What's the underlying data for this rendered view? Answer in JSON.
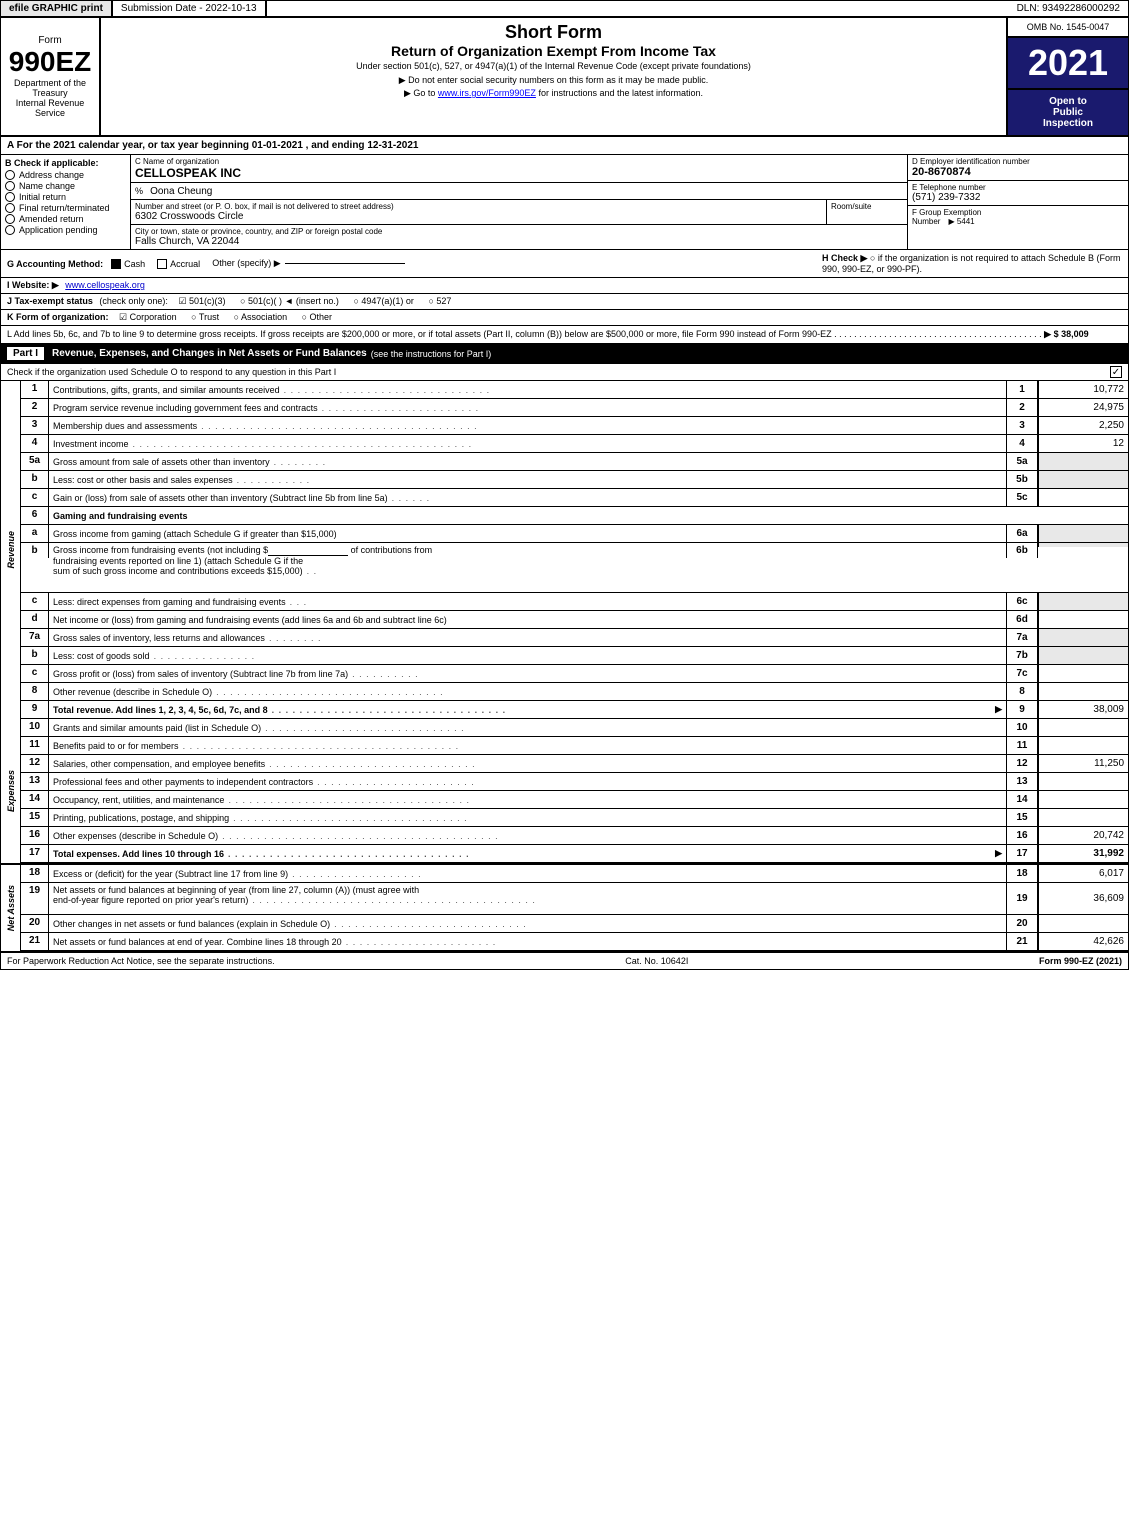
{
  "topBar": {
    "efile": "efile GRAPHIC print",
    "submission": "Submission Date - 2022-10-13",
    "dln": "DLN: 93492286000292"
  },
  "header": {
    "formType": "990EZ",
    "deptLine1": "Department of the",
    "deptLine2": "Treasury",
    "deptLine3": "Internal Revenue",
    "deptLine4": "Service",
    "title1": "Short Form",
    "title2": "Return of Organization Exempt From Income Tax",
    "subtitle": "Under section 501(c), 527, or 4947(a)(1) of the Internal Revenue Code (except private foundations)",
    "bullet1": "▶ Do not enter social security numbers on this form as it may be made public.",
    "bullet2": "▶ Go to ",
    "link": "www.irs.gov/Form990EZ",
    "linkSuffix": " for instructions and the latest information.",
    "ombNo": "OMB No. 1545-0047",
    "year": "2021",
    "openInspection": "Open to\nPublic\nInspection"
  },
  "sectionA": {
    "text": "A  For the 2021 calendar year, or tax year beginning 01-01-2021 , and ending 12-31-2021"
  },
  "checkB": {
    "label": "B  Check if applicable:",
    "items": [
      {
        "label": "Address change",
        "checked": false
      },
      {
        "label": "Name change",
        "checked": false
      },
      {
        "label": "Initial return",
        "checked": false
      },
      {
        "label": "Final return/terminated",
        "checked": false
      },
      {
        "label": "Amended return",
        "checked": false
      },
      {
        "label": "Application pending",
        "checked": false
      }
    ]
  },
  "orgInfo": {
    "cLabel": "C  Name of organization",
    "orgName": "CELLOSPEAK INC",
    "pctLabel": "%",
    "personName": "Oona Cheung",
    "addressLabel": "Number and street (or P. O. box, if mail is not delivered to street address)",
    "address": "6302 Crosswoods Circle",
    "roomLabel": "Room/suite",
    "roomValue": "",
    "cityLabel": "City or town, state or province, country, and ZIP or foreign postal code",
    "city": "Falls Church, VA  22044",
    "dLabel": "D  Employer identification number",
    "ein": "20-8670874",
    "eLabel": "E  Telephone number",
    "phone": "(571) 239-7332",
    "fLabel": "F  Group Exemption",
    "fLabel2": "Number",
    "groupNumber": "▶ 5441"
  },
  "accounting": {
    "gLabel": "G  Accounting Method:",
    "cashChecked": true,
    "accrualChecked": false,
    "otherLabel": "Other (specify) ▶",
    "otherValue": "",
    "hLabel": "H  Check ▶",
    "hText": "○  if the organization is not required to attach Schedule B (Form 990, 990-EZ, or 990-PF)."
  },
  "website": {
    "iLabel": "I  Website: ▶",
    "url": "www.cellospeak.org"
  },
  "taxStatus": {
    "jLabel": "J  Tax-exempt status",
    "jSub": "(check only one):",
    "options": [
      {
        "label": "☑ 501(c)(3)",
        "checked": true
      },
      {
        "label": "○ 501(c)(  )  ◄ (insert no.)",
        "checked": false
      },
      {
        "label": "○ 4947(a)(1) or",
        "checked": false
      },
      {
        "label": "○ 527",
        "checked": false
      }
    ]
  },
  "formOrg": {
    "kLabel": "K  Form of organization:",
    "options": [
      {
        "label": "☑ Corporation",
        "checked": true
      },
      {
        "label": "○ Trust",
        "checked": false
      },
      {
        "label": "○ Association",
        "checked": false
      },
      {
        "label": "○ Other",
        "checked": false
      }
    ]
  },
  "addLines": {
    "lText": "L  Add lines 5b, 6c, and 7b to line 9 to determine gross receipts. If gross receipts are $200,000 or more, or if total assets (Part II, column (B)) below are $500,000 or more, file Form 990 instead of Form 990-EZ",
    "dots": ". . . . . . . . . . . . . . . . . . . . . . . . . . . . . . . . . . . . . . . . . .",
    "arrow": "▶",
    "amount": "$ 38,009"
  },
  "partI": {
    "label": "Part I",
    "title": "Revenue, Expenses, and Changes in Net Assets or Fund Balances",
    "titleNote": "(see the instructions for Part I)",
    "checkLine": "Check if the organization used Schedule O to respond to any question in this Part I",
    "rows": [
      {
        "num": "1",
        "desc": "Contributions, gifts, grants, and similar amounts received",
        "dots": ". . . . . . . . . . . . . . . . . . . . . . . . . . . . . .",
        "lineNum": "1",
        "amount": "10,772",
        "blank": false
      },
      {
        "num": "2",
        "desc": "Program service revenue including government fees and contracts",
        "dots": ". . . . . . . . . . . . . . . . . . . . . . .",
        "lineNum": "2",
        "amount": "24,975",
        "blank": false
      },
      {
        "num": "3",
        "desc": "Membership dues and assessments",
        "dots": ". . . . . . . . . . . . . . . . . . . . . . . . . . . . . . . . . . . . . . . .",
        "lineNum": "3",
        "amount": "2,250",
        "blank": false
      },
      {
        "num": "4",
        "desc": "Investment income",
        "dots": ". . . . . . . . . . . . . . . . . . . . . . . . . . . . . . . . . . . . . . . . . . . . . . . . .",
        "lineNum": "4",
        "amount": "12",
        "blank": false
      }
    ],
    "row5a": {
      "num": "5a",
      "desc": "Gross amount from sale of assets other than inventory",
      "dots": ". . . . . . . .",
      "lineNum": "5a",
      "amount": "",
      "blank": true
    },
    "row5b": {
      "num": "b",
      "desc": "Less: cost or other basis and sales expenses",
      "dots": ". . . . . . . . . . .",
      "lineNum": "5b",
      "amount": "",
      "blank": true
    },
    "row5c": {
      "num": "c",
      "desc": "Gain or (loss) from sale of assets other than inventory (Subtract line 5b from line 5a)",
      "dots": ". . . . . .",
      "lineNum": "5c",
      "amount": "",
      "blank": false
    },
    "row6header": {
      "num": "6",
      "desc": "Gaming and fundraising events"
    },
    "row6a": {
      "num": "a",
      "desc": "Gross income from gaming (attach Schedule G if greater than $15,000)",
      "lineNum": "6a",
      "amount": "",
      "blank": true
    },
    "row6b": {
      "num": "b",
      "desc1": "Gross income from fundraising events (not including $",
      "desc2": "of contributions from",
      "desc3": "fundraising events reported on line 1) (attach Schedule G if the",
      "desc4": "sum of such gross income and contributions exceeds $15,000)",
      "dots": ". .",
      "lineNum": "6b",
      "amount": "",
      "blank": true
    },
    "row6c": {
      "num": "c",
      "desc": "Less: direct expenses from gaming and fundraising events",
      "dots": ". . .",
      "lineNum": "6c",
      "amount": "",
      "blank": true
    },
    "row6d": {
      "num": "d",
      "desc": "Net income or (loss) from gaming and fundraising events (add lines 6a and 6b and subtract line 6c)",
      "lineNum": "6d",
      "amount": "",
      "blank": false
    },
    "row7a": {
      "num": "7a",
      "desc": "Gross sales of inventory, less returns and allowances",
      "dots": ". . . . . . . .",
      "lineNum": "7a",
      "amount": "",
      "blank": true
    },
    "row7b": {
      "num": "b",
      "desc": "Less: cost of goods sold",
      "dots": ". . . . . . . . . . . . . . .",
      "lineNum": "7b",
      "amount": "",
      "blank": true
    },
    "row7c": {
      "num": "c",
      "desc": "Gross profit or (loss) from sales of inventory (Subtract line 7b from line 7a)",
      "dots": ". . . . . . . . . .",
      "lineNum": "7c",
      "amount": "",
      "blank": false
    },
    "row8": {
      "num": "8",
      "desc": "Other revenue (describe in Schedule O)",
      "dots": ". . . . . . . . . . . . . . . . . . . . . . . . . . . . . . . . .",
      "lineNum": "8",
      "amount": "",
      "blank": false
    },
    "row9": {
      "num": "9",
      "desc": "Total revenue. Add lines 1, 2, 3, 4, 5c, 6d, 7c, and 8",
      "dots": ". . . . . . . . . . . . . . . . . . . . . . . . . . . . . . . . . .",
      "arrow": "▶",
      "lineNum": "9",
      "amount": "38,009",
      "blank": false
    }
  },
  "expenses": {
    "rows": [
      {
        "num": "10",
        "desc": "Grants and similar amounts paid (list in Schedule O)",
        "dots": ". . . . . . . . . . . . . . . . . . . . . . . . . . . . .",
        "lineNum": "10",
        "amount": "",
        "blank": false
      },
      {
        "num": "11",
        "desc": "Benefits paid to or for members",
        "dots": ". . . . . . . . . . . . . . . . . . . . . . . . . . . . . . . . . . . . . . . .",
        "lineNum": "11",
        "amount": "",
        "blank": false
      },
      {
        "num": "12",
        "desc": "Salaries, other compensation, and employee benefits",
        "dots": ". . . . . . . . . . . . . . . . . . . . . . . . . . . . . .",
        "lineNum": "12",
        "amount": "11,250",
        "blank": false
      },
      {
        "num": "13",
        "desc": "Professional fees and other payments to independent contractors",
        "dots": ". . . . . . . . . . . . . . . . . . . . . . .",
        "lineNum": "13",
        "amount": "",
        "blank": false
      },
      {
        "num": "14",
        "desc": "Occupancy, rent, utilities, and maintenance",
        "dots": ". . . . . . . . . . . . . . . . . . . . . . . . . . . . . . . . . . .",
        "lineNum": "14",
        "amount": "",
        "blank": false
      },
      {
        "num": "15",
        "desc": "Printing, publications, postage, and shipping",
        "dots": ". . . . . . . . . . . . . . . . . . . . . . . . . . . . . . . . . .",
        "lineNum": "15",
        "amount": "",
        "blank": false
      },
      {
        "num": "16",
        "desc": "Other expenses (describe in Schedule O)",
        "dots": ". . . . . . . . . . . . . . . . . . . . . . . . . . . . . . . . . . . . . . . .",
        "lineNum": "16",
        "amount": "20,742",
        "blank": false
      },
      {
        "num": "17",
        "desc": "Total expenses. Add lines 10 through 16",
        "dots": ". . . . . . . . . . . . . . . . . . . . . . . . . . . . . . . . . . .",
        "arrow": "▶",
        "lineNum": "17",
        "amount": "31,992",
        "blank": false,
        "bold": true
      }
    ]
  },
  "netAssets": {
    "rows": [
      {
        "num": "18",
        "desc": "Excess or (deficit) for the year (Subtract line 17 from line 9)",
        "dots": ". . . . . . . . . . . . . . . . . . .",
        "lineNum": "18",
        "amount": "6,017",
        "blank": false
      },
      {
        "num": "19",
        "desc": "Net assets or fund balances at beginning of year (from line 27, column (A)) (must agree with",
        "desc2": "end-of-year figure reported on prior year's return)",
        "dots": ". . . . . . . . . . . . . . . . . . . . . . . . . . . . . . . . . . . . . . . . .",
        "lineNum": "19",
        "amount": "36,609",
        "blank": false
      },
      {
        "num": "20",
        "desc": "Other changes in net assets or fund balances (explain in Schedule O)",
        "dots": ". . . . . . . . . . . . . . . . . . . . . . . . . . . .",
        "lineNum": "20",
        "amount": "",
        "blank": false
      },
      {
        "num": "21",
        "desc": "Net assets or fund balances at end of year. Combine lines 18 through 20",
        "dots": ". . . . . . . . . . . . . . . . . . . . . .",
        "lineNum": "21",
        "amount": "42,626",
        "blank": false
      }
    ]
  },
  "footer": {
    "left": "For Paperwork Reduction Act Notice, see the separate instructions.",
    "cat": "Cat. No. 10642I",
    "right": "Form 990-EZ (2021)"
  }
}
